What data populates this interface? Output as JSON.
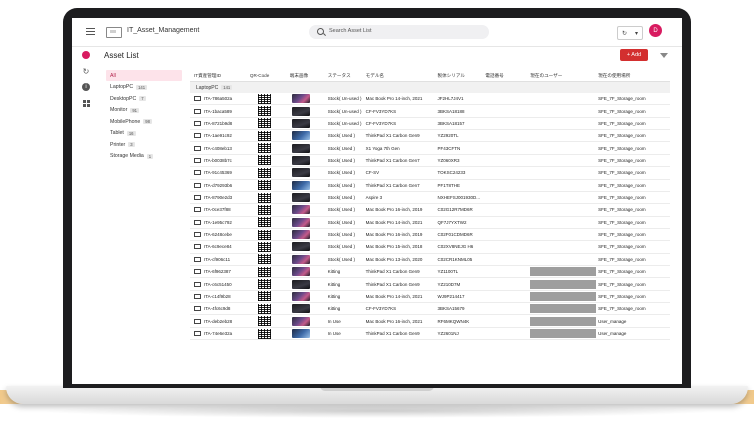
{
  "app": {
    "title": "IT_Asset_Management"
  },
  "search": {
    "placeholder": "Search Asset List"
  },
  "header": {
    "refresh_glyph": "↻",
    "avatar_initial": "D"
  },
  "page": {
    "title": "Asset List",
    "add_label": "+ Add"
  },
  "rail_icons": [
    "asset-icon",
    "history-icon",
    "info-icon",
    "grid-icon"
  ],
  "categories": [
    {
      "label": "All",
      "count": ""
    },
    {
      "label": "LaptopPC",
      "count": "141"
    },
    {
      "label": "DesktopPC",
      "count": "7"
    },
    {
      "label": "Monitor",
      "count": "91"
    },
    {
      "label": "MobilePhone",
      "count": "98"
    },
    {
      "label": "Tablet",
      "count": "16"
    },
    {
      "label": "Printer",
      "count": "3"
    },
    {
      "label": "Storage Media",
      "count": "1"
    }
  ],
  "table": {
    "columns": [
      "IT資産管理ID",
      "QR-Code",
      "端末画像",
      "ステータス",
      "モデル名",
      "製体シリアル",
      "電話番号",
      "現在のユーザー",
      "現在の使用場所"
    ],
    "group_label": "LaptopPC",
    "group_count": "141",
    "rows": [
      {
        "id": "ITA-786a502a",
        "status": "Stock( Un-used )",
        "model": "Mac Book Pro 14-inch, 2021",
        "serial": "JF2HL7J4V1",
        "phone": "",
        "user": "",
        "location": "SFE_7F_Storage_room",
        "thumb": "pink",
        "user_box": false
      },
      {
        "id": "ITA-1baca589",
        "status": "Stock( Un-used )",
        "model": "CF-FV3YD7KS",
        "serial": "3BKSA18188",
        "phone": "",
        "user": "",
        "location": "SFE_7F_Storage_room",
        "thumb": "dark",
        "user_box": false
      },
      {
        "id": "ITA-8721b9d8",
        "status": "Stock( Un-used )",
        "model": "CF-FV3YD7KS",
        "serial": "3BKSA18157",
        "phone": "",
        "user": "",
        "location": "SFE_7F_Storage_room",
        "thumb": "dark",
        "user_box": false
      },
      {
        "id": "ITA-1ae91c92",
        "status": "Stock( Used )",
        "model": "ThinkPad X1 Carbon Gen9",
        "serial": "YZ2920TL",
        "phone": "",
        "user": "",
        "location": "SFE_7F_Storage_room",
        "thumb": "blue",
        "user_box": false
      },
      {
        "id": "ITA-c408eb13",
        "status": "Stock( Used )",
        "model": "X1 Yoga 7th Gen",
        "serial": "PF43CFTN",
        "phone": "",
        "user": "",
        "location": "SFE_7F_Storage_room",
        "thumb": "dark",
        "user_box": false
      },
      {
        "id": "ITA-b0038b7c",
        "status": "Stock( Used )",
        "model": "ThinkPad X1 Carbon Gen7",
        "serial": "YZ060XR3",
        "phone": "",
        "user": "",
        "location": "SFE_7F_Storage_room",
        "thumb": "dark",
        "user_box": false
      },
      {
        "id": "ITA-91c45369",
        "status": "Stock( Used )",
        "model": "CF-SV",
        "serial": "TOKSC24233",
        "phone": "",
        "user": "",
        "location": "SFE_7F_Storage_room",
        "thumb": "dark",
        "user_box": false
      },
      {
        "id": "ITA-d79293b6",
        "status": "Stock( Used )",
        "model": "ThinkPad X1 Carbon Gen7",
        "serial": "PF1T8THE",
        "phone": "",
        "user": "",
        "location": "SFE_7F_Storage_room",
        "thumb": "blue",
        "user_box": false
      },
      {
        "id": "ITA-8790e2d3",
        "status": "Stock( Used )",
        "model": "Aspire 3",
        "serial": "NXHEFSJ001930D...",
        "phone": "",
        "user": "",
        "location": "SFE_7F_Storage_room",
        "thumb": "dark",
        "user_box": false
      },
      {
        "id": "ITA-0ce37f88",
        "status": "Stock( Used )",
        "model": "Mac Book Pro 16-inch, 2019",
        "serial": "C02G12R7MD6R",
        "phone": "",
        "user": "",
        "location": "SFE_7F_Storage_room",
        "thumb": "pink",
        "user_box": false
      },
      {
        "id": "ITA-1e95c792",
        "status": "Stock( Used )",
        "model": "Mac Book Pro 14-inch, 2021",
        "serial": "QF7J7YXTW2",
        "phone": "",
        "user": "",
        "location": "SFE_7F_Storage_room",
        "thumb": "pink",
        "user_box": false
      },
      {
        "id": "ITA-6248cebe",
        "status": "Stock( Used )",
        "model": "Mac Book Pro 16-inch, 2019",
        "serial": "C02F01CDMD6R",
        "phone": "",
        "user": "",
        "location": "SFE_7F_Storage_room",
        "thumb": "pink",
        "user_box": false
      },
      {
        "id": "ITA-6c9ece84",
        "status": "Stock( Used )",
        "model": "Mac Book Pro 15-inch, 2018",
        "serial": "C02XV8NEJG H6",
        "phone": "",
        "user": "",
        "location": "SFE_7F_Storage_room",
        "thumb": "dark",
        "user_box": false
      },
      {
        "id": "ITA-cf906c11",
        "status": "Stock( Used )",
        "model": "Mac Book Pro 13-inch, 2020",
        "serial": "C02CR1KNML05",
        "phone": "",
        "user": "",
        "location": "SFE_7F_Storage_room",
        "thumb": "pink",
        "user_box": false
      },
      {
        "id": "ITA-6f962387",
        "status": "Kitting",
        "model": "ThinkPad X1 Carbon Gen9",
        "serial": "YZ1100TL",
        "phone": "",
        "user": "",
        "location": "SFE_7F_Storage_room",
        "thumb": "pink",
        "user_box": true
      },
      {
        "id": "ITA-c6c51450",
        "status": "Kitting",
        "model": "ThinkPad X1 Carbon Gen9",
        "serial": "YZ210D7M",
        "phone": "",
        "user": "",
        "location": "SFE_7F_Storage_room",
        "thumb": "dark",
        "user_box": true
      },
      {
        "id": "ITA-c14f9b28",
        "status": "Kitting",
        "model": "Mac Book Pro 14-inch, 2021",
        "serial": "WJ9P214417",
        "phone": "",
        "user": "",
        "location": "SFE_7F_Storage_room",
        "thumb": "pink",
        "user_box": true
      },
      {
        "id": "ITA-4fc6c9d8",
        "status": "Kitting",
        "model": "CF-FV3YD7KS",
        "serial": "3BKSA15679",
        "phone": "",
        "user": "",
        "location": "SFE_7F_Storage_room",
        "thumb": "dark",
        "user_box": true
      },
      {
        "id": "ITA-deb2eb28",
        "status": "In Use",
        "model": "Mac Book Pro 16-inch, 2021",
        "serial": "RF6MKQWN4K",
        "phone": "",
        "user": "",
        "location": "User_manage",
        "thumb": "pink",
        "user_box": true
      },
      {
        "id": "ITA-74e6e32a",
        "status": "In Use",
        "model": "ThinkPad X1 Carbon Gen9",
        "serial": "YZ2601NJ",
        "phone": "",
        "user": "",
        "location": "User_manage",
        "thumb": "blue",
        "user_box": true
      }
    ]
  }
}
